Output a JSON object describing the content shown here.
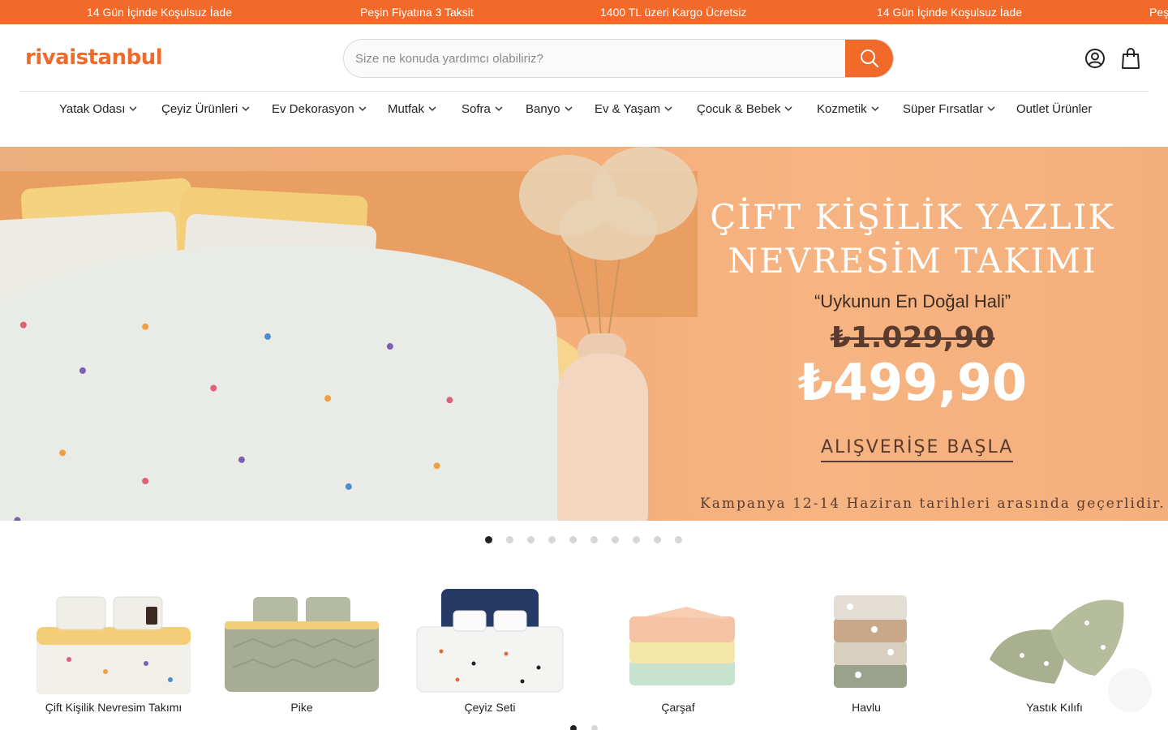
{
  "announcements": [
    "14 Gün İçinde Koşulsuz İade",
    "Peşin Fiyatına 3 Taksit",
    "1400 TL üzeri Kargo Ücretsiz",
    "14 Gün İçinde Koşulsuz İade",
    "Peş"
  ],
  "header": {
    "logo": "rivaistanbul",
    "search_placeholder": "Size ne konuda yardımcı olabiliriz?",
    "icons": [
      "search-icon",
      "account-icon",
      "cart-icon"
    ]
  },
  "nav": [
    {
      "label": "Yatak Odası",
      "dropdown": true
    },
    {
      "label": "Çeyiz Ürünleri",
      "dropdown": true
    },
    {
      "label": "Ev Dekorasyon",
      "dropdown": true
    },
    {
      "label": "Mutfak",
      "dropdown": true
    },
    {
      "label": "Sofra",
      "dropdown": true
    },
    {
      "label": "Banyo",
      "dropdown": true
    },
    {
      "label": "Ev & Yaşam",
      "dropdown": true
    },
    {
      "label": "Çocuk & Bebek",
      "dropdown": true
    },
    {
      "label": "Kozmetik",
      "dropdown": true
    },
    {
      "label": "Süper Fırsatlar",
      "dropdown": true
    },
    {
      "label": "Outlet Ürünler",
      "dropdown": false
    }
  ],
  "hero": {
    "title_line1": "ÇİFT KİŞİLİK YAZLIK",
    "title_line2": "NEVRESİM TAKIMI",
    "subtitle": "“Uykunun En Doğal Hali”",
    "old_price": "₺1.029,90",
    "new_price": "₺499,90",
    "cta": "ALIŞVERİŞE BAŞLA",
    "note": "Kampanya 12-14 Haziran tarihleri arasında geçerlidir."
  },
  "carousel": {
    "total": 10,
    "active": 0
  },
  "categories": [
    {
      "label": "Çift Kişilik Nevresim Takımı"
    },
    {
      "label": "Pike"
    },
    {
      "label": "Çeyiz Seti"
    },
    {
      "label": "Çarşaf"
    },
    {
      "label": "Havlu"
    },
    {
      "label": "Yastık Kılıfı"
    }
  ],
  "category_pager": {
    "total": 2,
    "active": 0
  },
  "colors": {
    "brand": "#f26a2a",
    "hero_bg": "#f3ad78"
  }
}
